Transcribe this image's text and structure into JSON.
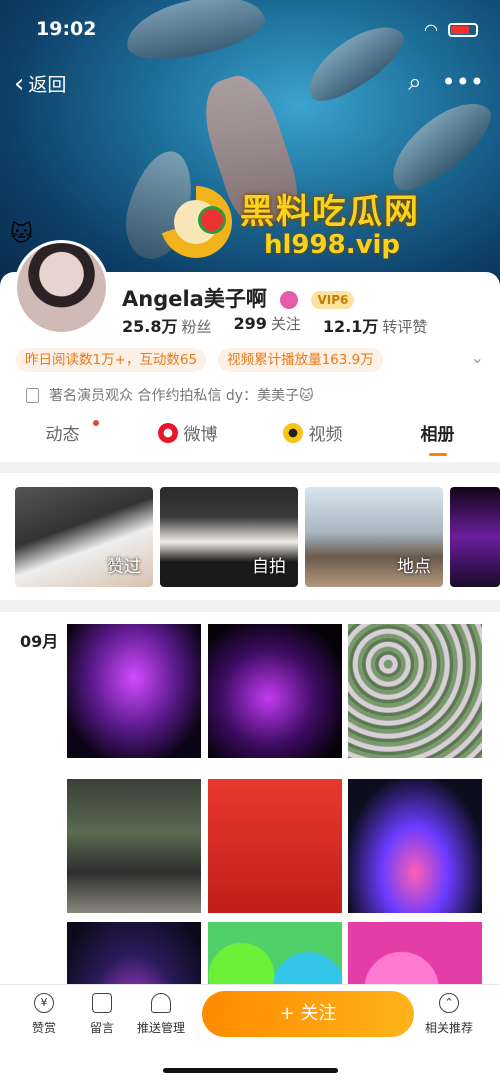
{
  "status_bar": {
    "time": "19:02"
  },
  "nav": {
    "back_label": "返回"
  },
  "watermark": {
    "title": "黑料吃瓜网",
    "url": "hl998.vip"
  },
  "profile": {
    "name": "Angela美子啊",
    "vip_label": "VIP6",
    "stats": [
      {
        "value": "25.8万",
        "label": "粉丝"
      },
      {
        "value": "299",
        "label": "关注"
      },
      {
        "value": "12.1万",
        "label": "转评赞"
      }
    ],
    "chips": [
      "昨日阅读数1万+，互动数65",
      "视频累计播放量163.9万"
    ],
    "bio": "著名演员观众 合作约拍私信 dy：美美子🐱"
  },
  "tabs": [
    {
      "label": "动态"
    },
    {
      "label": "微博"
    },
    {
      "label": "视频"
    },
    {
      "label": "相册"
    }
  ],
  "albums": [
    {
      "label": "赞过"
    },
    {
      "label": "自拍"
    },
    {
      "label": "地点"
    }
  ],
  "grid": {
    "month": "09月"
  },
  "bottom_bar": {
    "items": [
      {
        "label": "赞赏",
        "icon": "reward-icon"
      },
      {
        "label": "留言",
        "icon": "message-icon"
      },
      {
        "label": "推送管理",
        "icon": "bell-icon"
      },
      {
        "label": "相关推荐",
        "icon": "recommend-icon"
      }
    ],
    "follow_label": "+ 关注"
  },
  "colors": {
    "accent": "#ff8200",
    "chip_text": "#e77a1d",
    "chip_bg": "#fdf0e4",
    "follow_start": "#ff8a00",
    "follow_end": "#ffb31a"
  }
}
